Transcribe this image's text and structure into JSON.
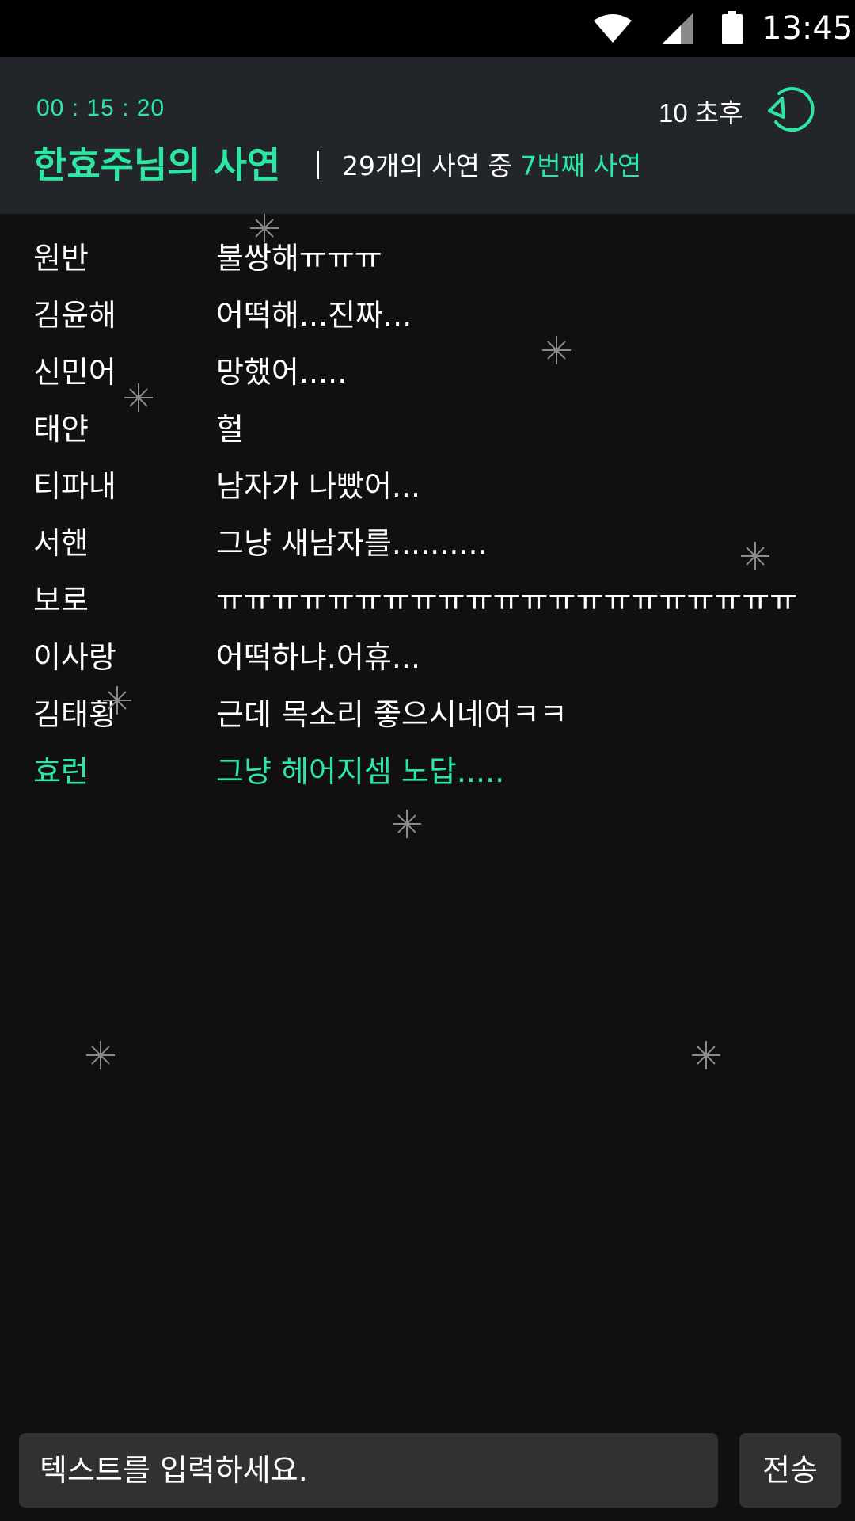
{
  "status_bar": {
    "time": "13:45",
    "icons": [
      "wifi-icon",
      "signal-icon",
      "battery-icon"
    ]
  },
  "header": {
    "timer": "00 : 15 : 20",
    "countdown": "10 초후",
    "title": "한효주님의 사연",
    "story_info_prefix": "29개의 사연 중 ",
    "story_info_highlight": "7번째 사연"
  },
  "messages": [
    {
      "name": "원반",
      "text": "불쌍해ㅠㅠㅠ"
    },
    {
      "name": "김윤해",
      "text": "어떡해...진짜..."
    },
    {
      "name": "신민어",
      "text": "망했어....."
    },
    {
      "name": "태얀",
      "text": "헐"
    },
    {
      "name": "티파내",
      "text": "남자가 나빴어..."
    },
    {
      "name": "서핸",
      "text": "그냥 새남자를.........."
    },
    {
      "name": "보로",
      "text": "ㅠㅠㅠㅠㅠㅠㅠㅠㅠㅠㅠㅠㅠㅠㅠㅠㅠㅠㅠㅠㅠ"
    },
    {
      "name": "이사랑",
      "text": "어떡하냐.어휴..."
    },
    {
      "name": "김태횡",
      "text": "근데 목소리 좋으시네여ㅋㅋ"
    },
    {
      "name": "효런",
      "text": "그냥 헤어지셈 노답.....",
      "self": true
    }
  ],
  "input": {
    "placeholder": "텍스트를 입력하세요.",
    "send_label": "전송"
  },
  "colors": {
    "accent": "#2ee6a4",
    "background": "#101010",
    "header_bg": "#22252a",
    "input_bg": "#313131"
  }
}
